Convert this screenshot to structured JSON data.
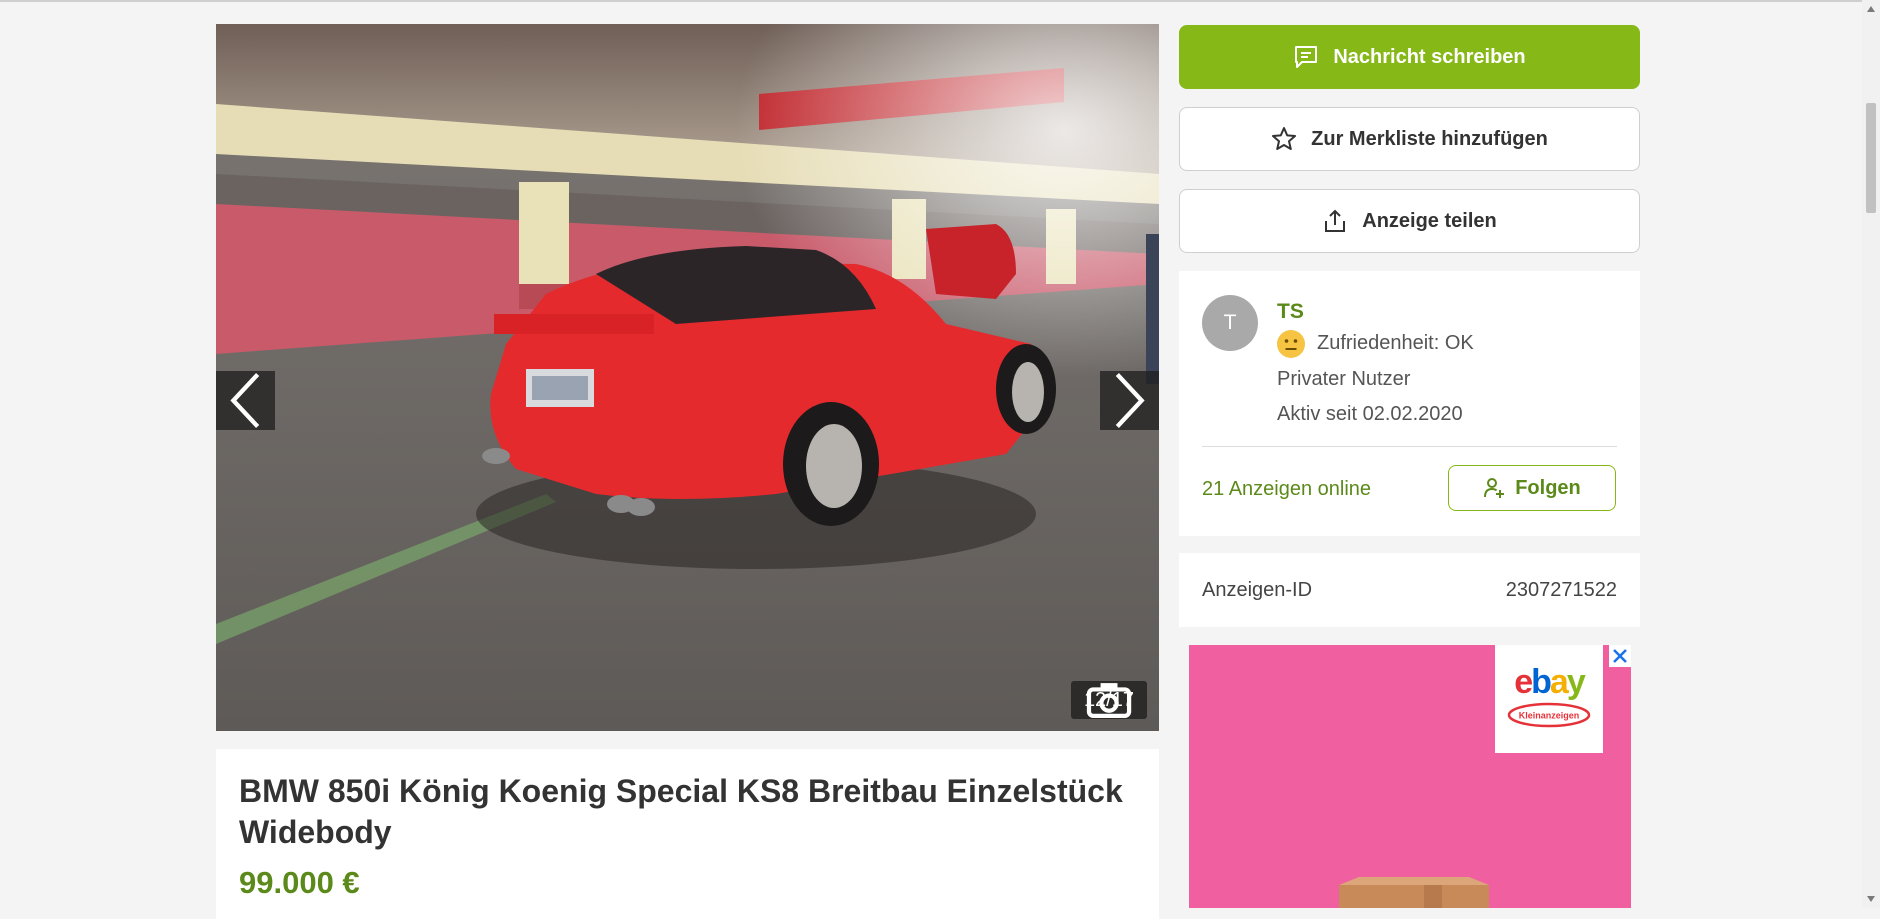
{
  "breadcrumb_fragment": "…",
  "gallery": {
    "counter": "12/17",
    "prev_label": "",
    "next_label": ""
  },
  "listing": {
    "title": "BMW 850i König Koenig Special KS8 Breitbau Einzelstück Widebody",
    "price": "99.000 €"
  },
  "actions": {
    "message_label": "Nachricht schreiben",
    "watchlist_label": "Zur Merkliste hinzufügen",
    "share_label": "Anzeige teilen"
  },
  "seller": {
    "initial": "T",
    "name": "TS",
    "satisfaction": "Zufriedenheit: OK",
    "type": "Privater Nutzer",
    "active_since": "Aktiv seit 02.02.2020",
    "ads_online": "21 Anzeigen online",
    "follow_label": "Folgen"
  },
  "details": {
    "id_label": "Anzeigen-ID",
    "id_value": "2307271522"
  },
  "ad": {
    "brand_logo_text": "ebay",
    "brand_subtitle": "Kleinanzeigen"
  },
  "colors": {
    "brand_green": "#86b817",
    "text_green": "#5c8a1a",
    "ad_pink": "#f05fa0",
    "car_red": "#e52a2e"
  },
  "icons": {
    "message": "chat-bubble-icon",
    "watchlist": "star-icon",
    "share": "share-upload-icon",
    "follow": "person-plus-icon",
    "counter": "camera-icon",
    "satisfaction": "neutral-smiley-icon"
  }
}
